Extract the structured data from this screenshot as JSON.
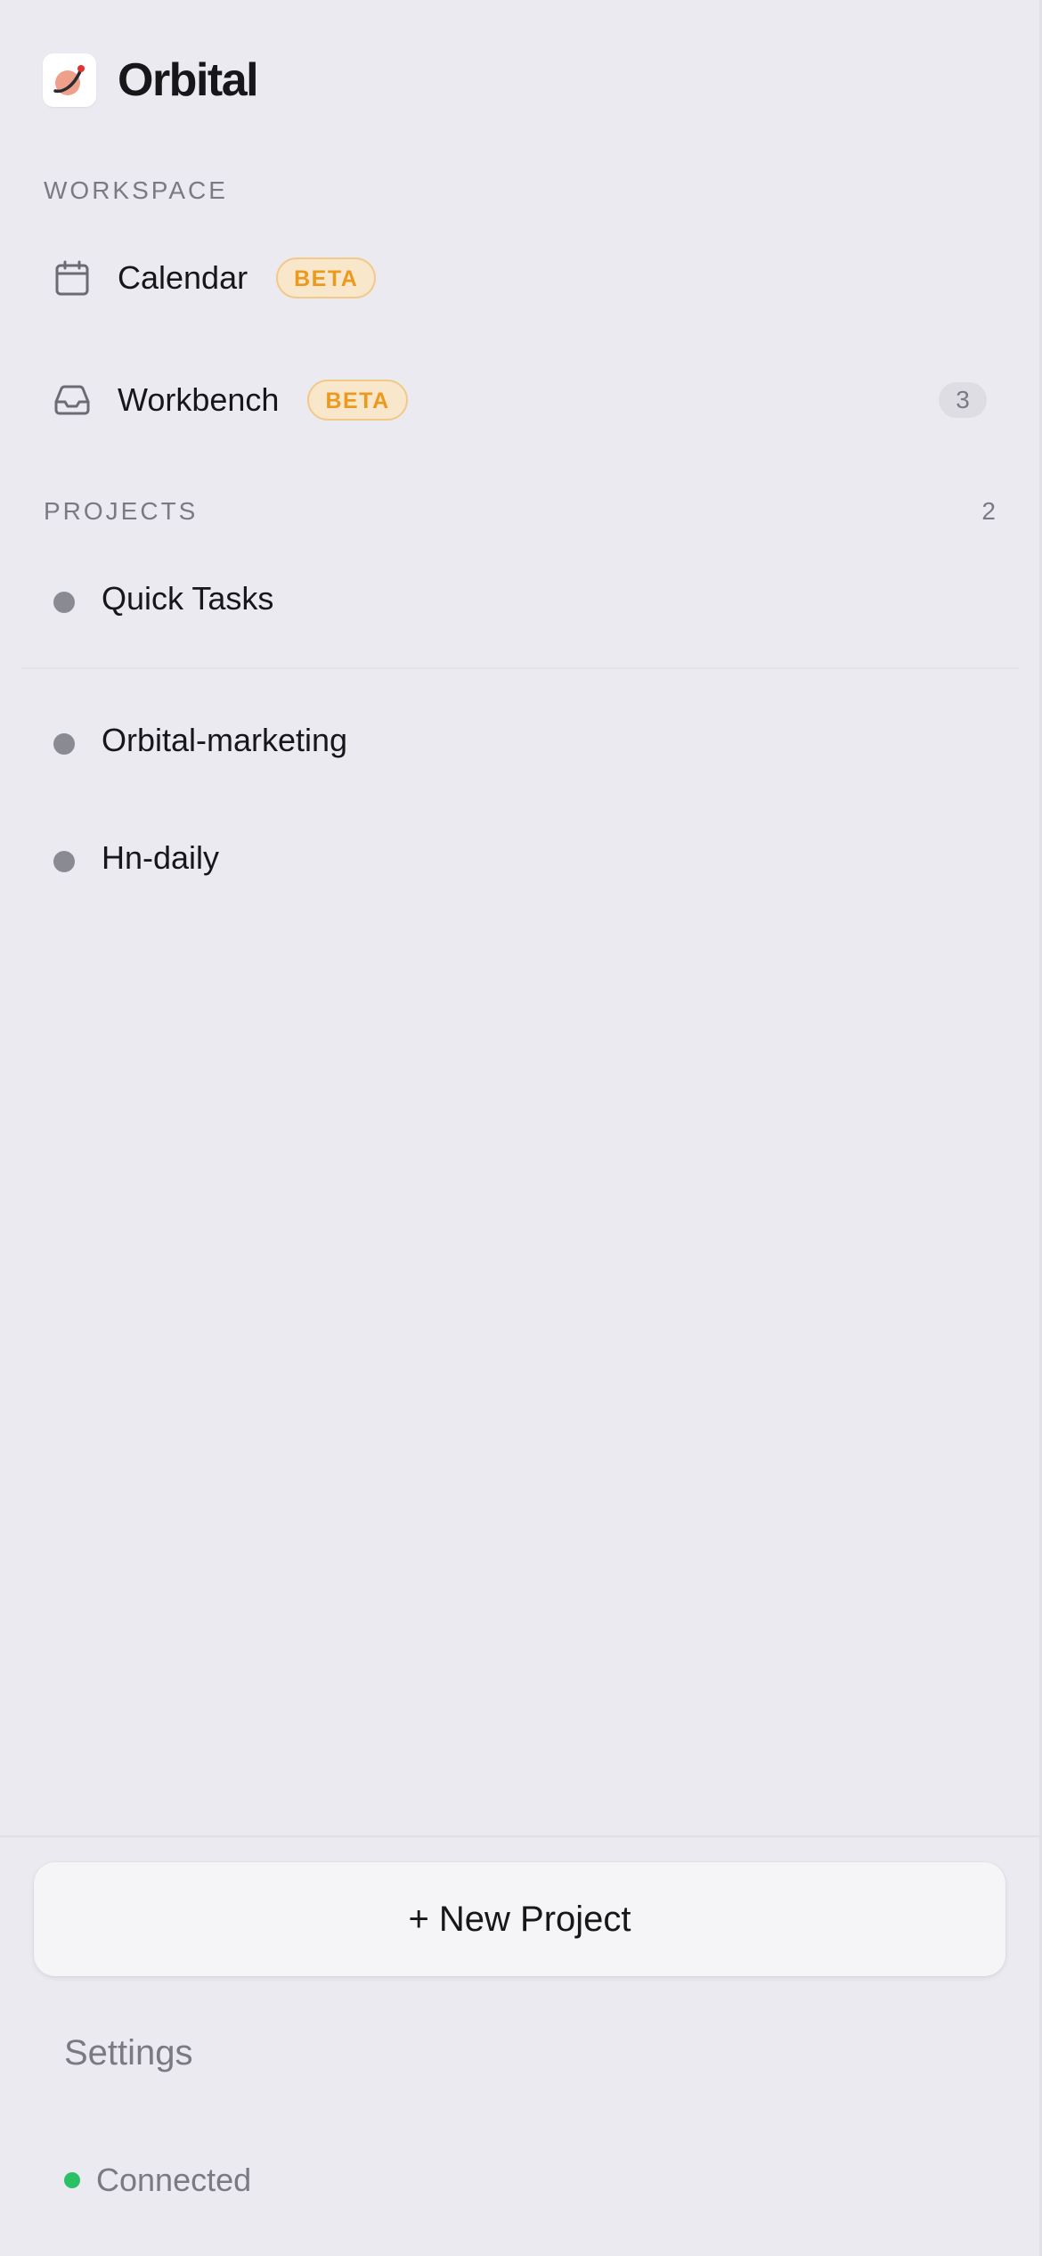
{
  "app": {
    "title": "Orbital",
    "logo_icon": "orbital-logo"
  },
  "workspace": {
    "label": "WORKSPACE",
    "items": [
      {
        "label": "Calendar",
        "icon": "calendar-icon",
        "badge": "BETA"
      },
      {
        "label": "Workbench",
        "icon": "inbox-tray-icon",
        "badge": "BETA",
        "count": "3"
      }
    ]
  },
  "projects": {
    "label": "PROJECTS",
    "count": "2",
    "items": [
      {
        "label": "Quick Tasks"
      },
      {
        "label": "Orbital-marketing"
      },
      {
        "label": "Hn-daily"
      }
    ]
  },
  "footer": {
    "new_project_label": "+ New Project",
    "settings_label": "Settings",
    "status_text": "Connected"
  },
  "colors": {
    "background": "#EBEAF0",
    "beta_badge_text": "#EC9A1E",
    "beta_badge_bg": "#F8E7CB",
    "status_connected": "#2BC065",
    "project_dot": "#8A8A93"
  }
}
